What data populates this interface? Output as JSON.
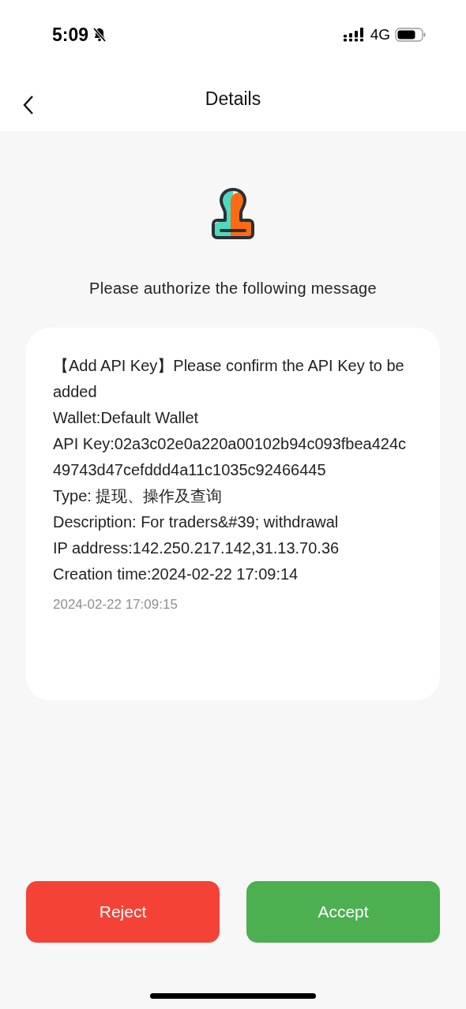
{
  "status_bar": {
    "time": "5:09",
    "network": "4G"
  },
  "header": {
    "title": "Details"
  },
  "prompt": "Please authorize the following message",
  "message": {
    "lines": [
      "【Add API Key】Please confirm the API Key to be added",
      "Wallet:Default Wallet",
      "API Key:02a3c02e0a220a00102b94c093fbea424c49743d47cefddd4a11c1035c92466445",
      "Type: 提现、操作及查询",
      "Description: For traders&#39; withdrawal",
      "IP address:142.250.217.142,31.13.70.36",
      "Creation time:2024-02-22 17:09:14"
    ],
    "timestamp": "2024-02-22 17:09:15"
  },
  "buttons": [
    {
      "label": "Reject",
      "kind": "reject"
    },
    {
      "label": "Accept",
      "kind": "accept"
    }
  ]
}
